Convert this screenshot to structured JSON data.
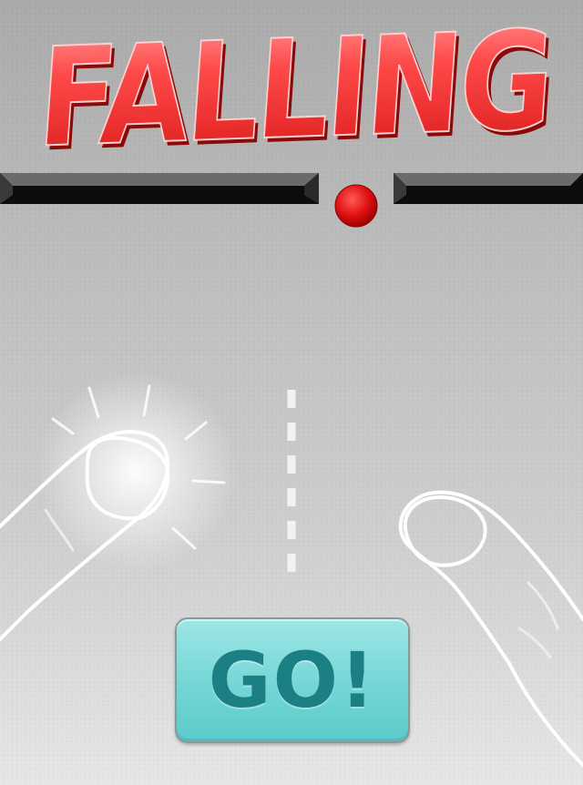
{
  "title": {
    "text": "FALLING"
  },
  "go_button": {
    "label": "GO!"
  },
  "colors": {
    "title_red": "#f02a2a",
    "ball_red": "#e01010",
    "ledge_dark": "#111111",
    "button_teal": "#74d6d6",
    "button_text": "#1c7f84"
  },
  "icons": [
    "falling-ball",
    "tap-left-hand-icon",
    "tap-right-hand-icon",
    "divider-dashed-line"
  ]
}
